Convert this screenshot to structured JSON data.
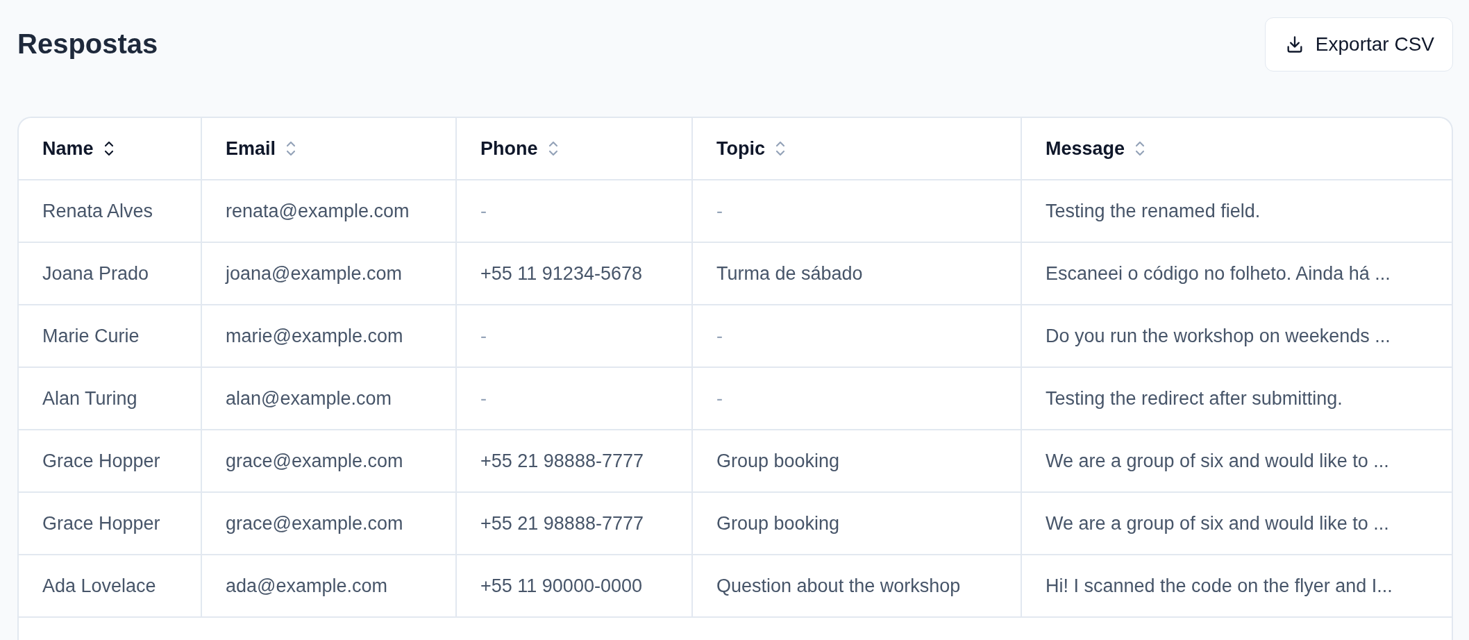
{
  "page": {
    "title": "Respostas"
  },
  "export_button": {
    "label": "Exportar CSV"
  },
  "table": {
    "columns": [
      {
        "label": "Name",
        "sort_active": true
      },
      {
        "label": "Email",
        "sort_active": false
      },
      {
        "label": "Phone",
        "sort_active": false
      },
      {
        "label": "Topic",
        "sort_active": false
      },
      {
        "label": "Message",
        "sort_active": false
      }
    ],
    "rows": [
      [
        "Renata Alves",
        "renata@example.com",
        "-",
        "-",
        "Testing the renamed field."
      ],
      [
        "Joana Prado",
        "joana@example.com",
        "+55 11 91234-5678",
        "Turma de sábado",
        "Escaneei o código no folheto. Ainda há ..."
      ],
      [
        "Marie Curie",
        "marie@example.com",
        "-",
        "-",
        "Do you run the workshop on weekends ..."
      ],
      [
        "Alan Turing",
        "alan@example.com",
        "-",
        "-",
        "Testing the redirect after submitting."
      ],
      [
        "Grace Hopper",
        "grace@example.com",
        "+55 21 98888-7777",
        "Group booking",
        "We are a group of six and would like to ..."
      ],
      [
        "Grace Hopper",
        "grace@example.com",
        "+55 21 98888-7777",
        "Group booking",
        "We are a group of six and would like to ..."
      ],
      [
        "Ada Lovelace",
        "ada@example.com",
        "+55 11 90000-0000",
        "Question about the workshop",
        "Hi! I scanned the code on the flyer and I..."
      ]
    ]
  }
}
